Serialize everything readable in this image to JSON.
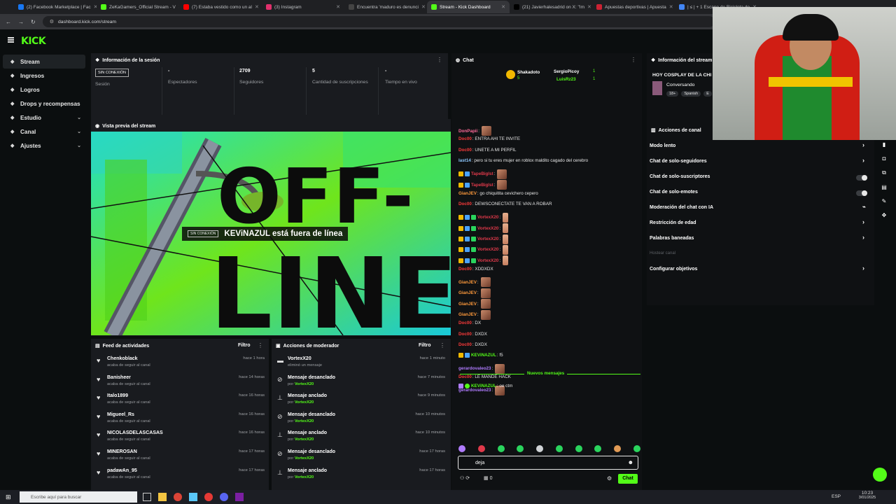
{
  "browser": {
    "tabs": [
      {
        "title": "(2) Facebook Marketplace | Fac",
        "color": "#1877f2"
      },
      {
        "title": "ZeKaGamers_Official Stream - V",
        "color": "#53fc18"
      },
      {
        "title": "(7) Estaba vestido como un al",
        "color": "#ff0000"
      },
      {
        "title": "(3) Instagram",
        "color": "#e1306c"
      },
      {
        "title": "Encuentra 'maduro es denunci",
        "color": "#444"
      },
      {
        "title": "Stream - Kick Dashboard",
        "color": "#53fc18"
      },
      {
        "title": "(21) Javierhalesadrid on X: \"Im",
        "color": "#000000"
      },
      {
        "title": "Apuestas deportivas | Apuesta",
        "color": "#cc2233"
      },
      {
        "title": "| ≤ | + 1 Escape de Bicicleta de",
        "color": "#4285f4"
      }
    ],
    "url": "dashboard.kick.com/stream"
  },
  "app": {
    "logo": "KICK"
  },
  "sidebar": {
    "items": [
      {
        "label": "Stream",
        "icon": "broadcast-icon"
      },
      {
        "label": "Ingresos",
        "icon": "money-icon"
      },
      {
        "label": "Logros",
        "icon": "trophy-icon"
      },
      {
        "label": "Drops y recompensas",
        "icon": "gift-icon"
      },
      {
        "label": "Estudio",
        "icon": "studio-icon",
        "chev": "⌄"
      },
      {
        "label": "Canal",
        "icon": "channel-icon",
        "chev": "⌄"
      },
      {
        "label": "Ajustes",
        "icon": "gear-icon",
        "chev": "⌄"
      }
    ]
  },
  "session": {
    "title": "Información de la sesión",
    "status_badge": "SIN CONEXIÓN",
    "status_label": "Sesión",
    "stats": [
      {
        "value": "-",
        "label": "Espectadores"
      },
      {
        "value": "2709",
        "label": "Seguidores"
      },
      {
        "value": "5",
        "label": "Cantidad de suscripciones"
      },
      {
        "value": "-",
        "label": "Tiempo en vivo"
      }
    ]
  },
  "preview": {
    "title": "Vista previa del stream",
    "offline_word_1": "OFF-",
    "offline_word_2": "LINE",
    "badge": "SIN CONEXIÓN",
    "message": "KEViNAZUL está fuera de línea"
  },
  "activity_feed": {
    "title": "Feed de actividades",
    "filter": "Filtro",
    "items": [
      {
        "name": "Chenkoblack",
        "sub": "acaba de seguir al canal",
        "time": "hace 1 hora"
      },
      {
        "name": "Banisheer",
        "sub": "acaba de seguir al canal",
        "time": "hace 14 horas"
      },
      {
        "name": "Italo1899",
        "sub": "acaba de seguir al canal",
        "time": "hace 16 horas"
      },
      {
        "name": "Migueel_Rs",
        "sub": "acaba de seguir al canal",
        "time": "hace 16 horas"
      },
      {
        "name": "NICOLASDELASCASAS",
        "sub": "acaba de seguir al canal",
        "time": "hace 16 horas"
      },
      {
        "name": "MINEROSAN",
        "sub": "acaba de seguir al canal",
        "time": "hace 17 horas"
      },
      {
        "name": "padawAn_95",
        "sub": "acaba de seguir al canal",
        "time": "hace 17 horas"
      }
    ]
  },
  "mod_actions": {
    "title": "Acciones de moderador",
    "filter": "Filtro",
    "items": [
      {
        "name": "VortexX20",
        "sub_prefix": "eliminó un mensaje",
        "by": "",
        "time": "hace 1 minuto",
        "icon": "trash-icon"
      },
      {
        "name": "Mensaje desanclado",
        "sub_prefix": "por ",
        "by": "VortexX20",
        "time": "hace 7 minutos",
        "icon": "unpin-icon"
      },
      {
        "name": "Mensaje anclado",
        "sub_prefix": "por ",
        "by": "VortexX20",
        "time": "hace 9 minutos",
        "icon": "pin-icon"
      },
      {
        "name": "Mensaje desanclado",
        "sub_prefix": "por ",
        "by": "VortexX20",
        "time": "hace 10 minutos",
        "icon": "unpin-icon"
      },
      {
        "name": "Mensaje anclado",
        "sub_prefix": "por ",
        "by": "VortexX20",
        "time": "hace 10 minutos",
        "icon": "pin-icon"
      },
      {
        "name": "Mensaje desanclado",
        "sub_prefix": "por ",
        "by": "VortexX20",
        "time": "hace 17 horas",
        "icon": "unpin-icon"
      },
      {
        "name": "Mensaje anclado",
        "sub_prefix": "por ",
        "by": "VortexX20",
        "time": "hace 17 horas",
        "icon": "pin-icon"
      }
    ]
  },
  "chat": {
    "title": "Chat",
    "top_gifters": [
      {
        "name": "Shakadoto",
        "count": "5"
      },
      {
        "name": "SergioPicoy",
        "count": "1"
      },
      {
        "name": "LuisRz23",
        "count": "1"
      }
    ],
    "messages": [
      {
        "user": "DonPapii",
        "color": "#ff6b9a",
        "text": ":",
        "emote": true
      },
      {
        "user": "Doc00",
        "color": "#ff3b3b",
        "text": ": ENTRA AHI TE INVITE"
      },
      {
        "user": "Doc00",
        "color": "#ff3b3b",
        "text": ": UNETE A MI PERFIL"
      },
      {
        "user": "last14",
        "color": "#8ec9ff",
        "text": ": pero si tu eres mujer en roblox maldito cagado del cerebro"
      },
      {
        "user": "TapeBigIst",
        "color": "#e0394a",
        "text": ":",
        "emote": true,
        "badges": 2
      },
      {
        "user": "TapeBigIst",
        "color": "#e0394a",
        "text": ":",
        "emote": true,
        "badges": 2
      },
      {
        "user": "GianJEV",
        "color": "#ff9a3c",
        "text": ": go chiquitita cevichero cepero"
      },
      {
        "user": "Doc00",
        "color": "#ff3b3b",
        "text": ": DEWSCONECTATE TE VAN A ROBAR"
      },
      {
        "user": "VortexX20",
        "color": "#e0394a",
        "text": ":",
        "hand": true,
        "badges": 3
      },
      {
        "user": "VortexX20",
        "color": "#e0394a",
        "text": ":",
        "hand": true,
        "badges": 3
      },
      {
        "user": "VortexX20",
        "color": "#e0394a",
        "text": ":",
        "hand": true,
        "badges": 3
      },
      {
        "user": "VortexX20",
        "color": "#e0394a",
        "text": ":",
        "hand": true,
        "badges": 3
      },
      {
        "user": "VortexX20",
        "color": "#e0394a",
        "text": ":",
        "hand": true,
        "badges": 3
      },
      {
        "user": "Doc00",
        "color": "#ff3b3b",
        "text": ": XDDXDX"
      },
      {
        "user": "GianJEV",
        "color": "#ff9a3c",
        "text": ":",
        "emote": true
      },
      {
        "user": "GianJEV",
        "color": "#ff9a3c",
        "text": ":",
        "emote": true
      },
      {
        "user": "GianJEV",
        "color": "#ff9a3c",
        "text": ":",
        "emote": true
      },
      {
        "user": "GianJEV",
        "color": "#ff9a3c",
        "text": ":",
        "emote": true
      },
      {
        "user": "Doc00",
        "color": "#ff3b3b",
        "text": ": DX"
      },
      {
        "user": "Doc00",
        "color": "#ff3b3b",
        "text": ": DXDX"
      },
      {
        "user": "Doc00",
        "color": "#ff3b3b",
        "text": ": DXDX"
      },
      {
        "user": "KEViNAZUL",
        "color": "#53fc18",
        "text": ": f5",
        "badges": 2
      },
      {
        "user": "gerardovaleo23",
        "color": "#b07cff",
        "text": ":",
        "emote": true
      },
      {
        "user": "Doc00",
        "color": "#ff3b3b",
        "text": ": LE MANDE HACK"
      },
      {
        "user": "gerardovaleo23",
        "color": "#b07cff",
        "text": ":",
        "emote": true
      }
    ],
    "new_messages_label": "Nuevos mensajes",
    "after": {
      "user": "KEViNAZUL",
      "color": "#53fc18",
      "text": ": oe ctm"
    },
    "input_value": "deja",
    "send_label": "Chat",
    "count": "0"
  },
  "stream_info": {
    "title": "Información del stream",
    "stream_title": "HOY COSPLAY DE LA CHI",
    "category": "Conversando",
    "tags": [
      "18+",
      "Spanish",
      "E"
    ]
  },
  "channel_actions": {
    "title": "Acciones de canal",
    "rows": [
      {
        "label": "Modo lento",
        "control": "chevron"
      },
      {
        "label": "Chat de solo-seguidores",
        "control": "chevron"
      },
      {
        "label": "Chat de solo-suscriptores",
        "control": "toggle"
      },
      {
        "label": "Chat de solo-emotes",
        "control": "toggle"
      },
      {
        "label": "Moderación del chat con IA",
        "control": "icon"
      },
      {
        "label": "Restricción de edad",
        "control": "chevron"
      },
      {
        "label": "Palabras baneadas",
        "control": "chevron"
      },
      {
        "label": "Hostear canal",
        "control": "none",
        "muted": true
      },
      {
        "label": "Configurar objetivos",
        "control": "chevron"
      }
    ]
  },
  "taskbar": {
    "search_placeholder": "Escribe aquí para buscar",
    "lang": "ESP",
    "time": "10:23",
    "date": "3/01/2025"
  }
}
